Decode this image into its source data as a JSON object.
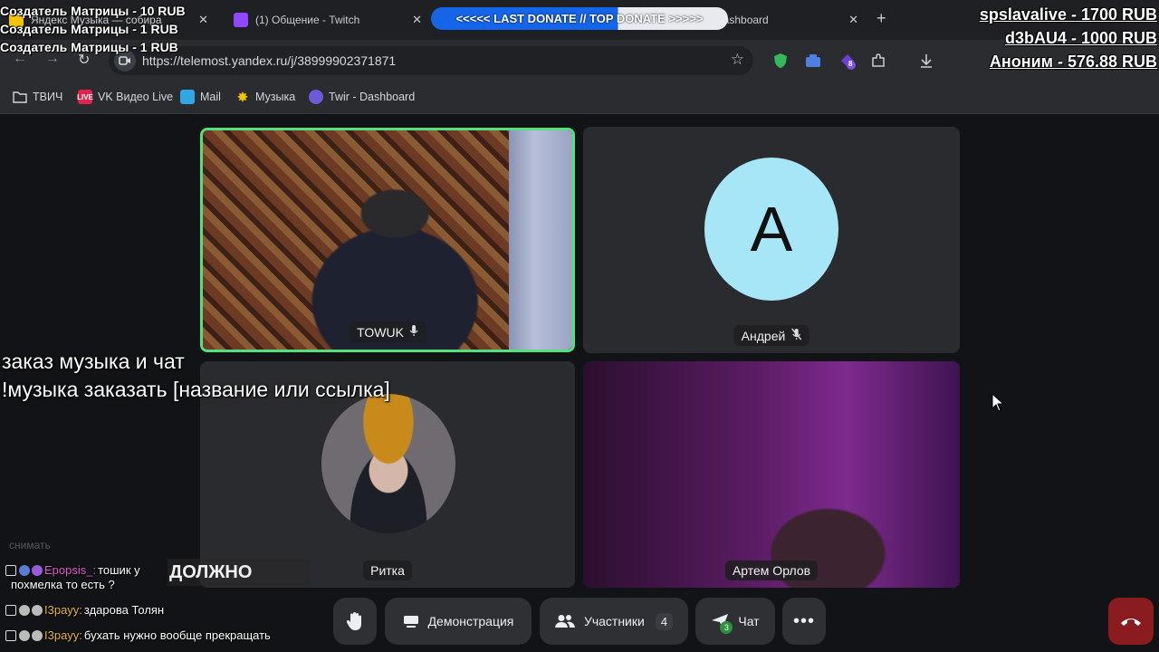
{
  "tabs": [
    {
      "title": "Яндекс Музыка — собира",
      "favicon_color": "#f5c400"
    },
    {
      "title": "(1) Общение - Twitch",
      "favicon_color": "#9146ff"
    },
    {
      "title": "Dashboard",
      "favicon_color": "#7a7f8a"
    }
  ],
  "address": {
    "url": "https://telemost.yandex.ru/j/38999902371871"
  },
  "extensions_badge": "8",
  "bookmarks": [
    {
      "label": "ТВИЧ",
      "icon": "folder-icon"
    },
    {
      "label": "VK Видео Live",
      "icon": "vk-live-icon"
    },
    {
      "label": "Mail",
      "icon": "mail-icon"
    },
    {
      "label": "Музыка",
      "icon": "music-icon"
    },
    {
      "label": "Twir - Dashboard",
      "icon": "twir-icon"
    }
  ],
  "participants": [
    {
      "name": "TOWUK",
      "speaking": true
    },
    {
      "name": "Андрей",
      "avatar_letter": "A",
      "muted": true
    },
    {
      "name": "Ритка"
    },
    {
      "name": "Артем Орлов"
    }
  ],
  "controls": {
    "demo_label": "Демонстрация",
    "participants_label": "Участники",
    "participants_count": "4",
    "chat_label": "Чат",
    "chat_badge": "3"
  },
  "overlay": {
    "donors_left": [
      "Создатель Матрицы - 10 RUB",
      "Создатель Матрицы - 1 RUB",
      "Создатель Матрицы - 1 RUB"
    ],
    "marquee": "<<<<< LAST DONATE // TOP DONATE >>>>>",
    "top_donors": [
      "spslavalive - 1700 RUB",
      "d3bAU4 - 1000 RUB",
      "Аноним - 576.88 RUB"
    ],
    "hint_line1": "заказ музыка и чат",
    "hint_line2": "!музыка заказать [название или ссылка]",
    "faded_text": "снимать",
    "big_word": "ДОЛЖНО"
  },
  "chat": [
    {
      "user": "Epopsis_:",
      "user_color": "#e05bd0",
      "text": "тошик у",
      "text2": "похмелка то есть ?"
    },
    {
      "user": "I3payy:",
      "user_color": "#e8b730",
      "text": "здарова Толян"
    },
    {
      "user": "I3payy:",
      "user_color": "#e8b730",
      "text": "бухать нужно вообще прекращать"
    }
  ],
  "colors": {
    "speaking_border": "#54e07a",
    "avatar_a": "#a7e6f7",
    "end_call": "#8a1c1f"
  }
}
